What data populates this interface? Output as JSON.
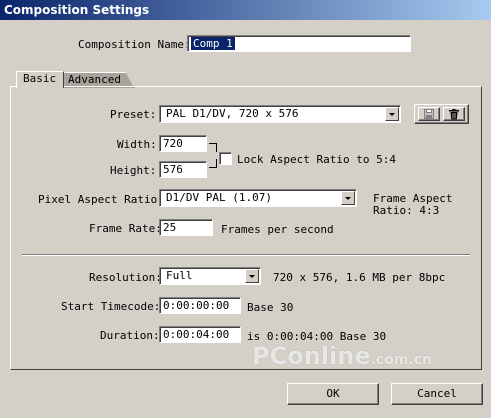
{
  "window": {
    "title": "Composition Settings"
  },
  "composition_name": {
    "label": "Composition Name:",
    "value": "Comp 1"
  },
  "tabs": [
    {
      "label": "Basic"
    },
    {
      "label": "Advanced"
    }
  ],
  "preset": {
    "label": "Preset:",
    "value": "PAL D1/DV, 720 x 576",
    "save_icon": "disk-icon",
    "delete_icon": "trash-icon"
  },
  "width": {
    "label": "Width:",
    "value": "720"
  },
  "height": {
    "label": "Height:",
    "value": "576"
  },
  "lock_aspect": {
    "label": "Lock Aspect Ratio to 5:4",
    "checked": false
  },
  "pixel_aspect": {
    "label": "Pixel Aspect Ratio:",
    "value": "D1/DV PAL (1.07)",
    "frame_aspect_line1": "Frame Aspect",
    "frame_aspect_line2": "Ratio: 4:3"
  },
  "frame_rate": {
    "label": "Frame Rate:",
    "value": "25",
    "unit": "Frames per second"
  },
  "resolution": {
    "label": "Resolution:",
    "value": "Full",
    "info": "720 x 576, 1.6 MB per 8bpc"
  },
  "start_timecode": {
    "label": "Start Timecode:",
    "value": "0:00:00:00",
    "info": "Base 30"
  },
  "duration": {
    "label": "Duration:",
    "value": "0:00:04:00",
    "info": "is 0:00:04:00  Base 30"
  },
  "buttons": {
    "ok": "OK",
    "cancel": "Cancel"
  },
  "watermark": {
    "text_main": "PConline",
    "text_suffix": ".com.cn"
  },
  "colors": {
    "titlebar_start": "#0a246a",
    "titlebar_end": "#a6caf0",
    "face": "#d4d0c8",
    "selection": "#0a246a"
  }
}
